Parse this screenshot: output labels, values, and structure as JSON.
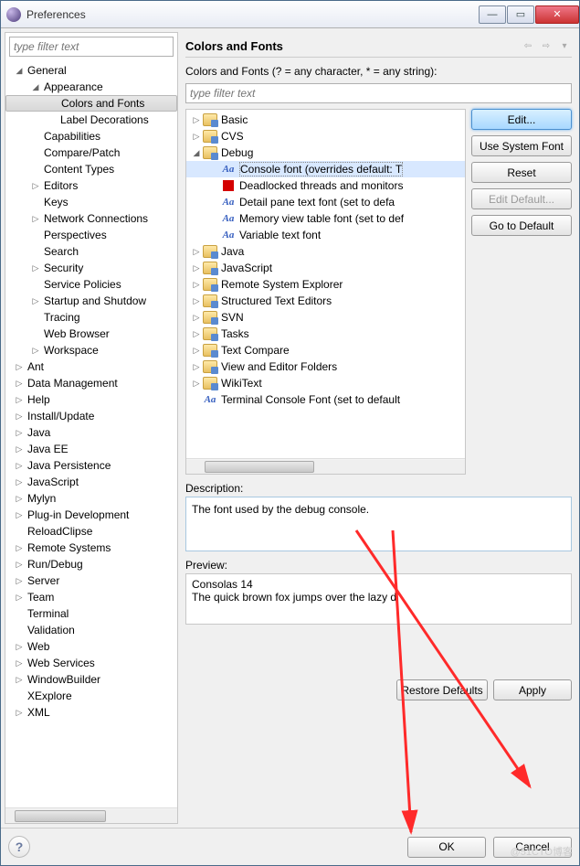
{
  "window": {
    "title": "Preferences"
  },
  "left_filter": {
    "placeholder": "type filter text"
  },
  "left_tree": [
    {
      "label": "General",
      "depth": 0,
      "exp": "open",
      "children": [
        {
          "label": "Appearance",
          "depth": 1,
          "exp": "open",
          "children": [
            {
              "label": "Colors and Fonts",
              "depth": 2,
              "selected": true
            },
            {
              "label": "Label Decorations",
              "depth": 2
            }
          ]
        },
        {
          "label": "Capabilities",
          "depth": 1
        },
        {
          "label": "Compare/Patch",
          "depth": 1
        },
        {
          "label": "Content Types",
          "depth": 1
        },
        {
          "label": "Editors",
          "depth": 1,
          "exp": "closed"
        },
        {
          "label": "Keys",
          "depth": 1
        },
        {
          "label": "Network Connections",
          "depth": 1,
          "exp": "closed"
        },
        {
          "label": "Perspectives",
          "depth": 1
        },
        {
          "label": "Search",
          "depth": 1
        },
        {
          "label": "Security",
          "depth": 1,
          "exp": "closed"
        },
        {
          "label": "Service Policies",
          "depth": 1
        },
        {
          "label": "Startup and Shutdow",
          "depth": 1,
          "exp": "closed"
        },
        {
          "label": "Tracing",
          "depth": 1
        },
        {
          "label": "Web Browser",
          "depth": 1
        },
        {
          "label": "Workspace",
          "depth": 1,
          "exp": "closed"
        }
      ]
    },
    {
      "label": "Ant",
      "depth": 0,
      "exp": "closed"
    },
    {
      "label": "Data Management",
      "depth": 0,
      "exp": "closed"
    },
    {
      "label": "Help",
      "depth": 0,
      "exp": "closed"
    },
    {
      "label": "Install/Update",
      "depth": 0,
      "exp": "closed"
    },
    {
      "label": "Java",
      "depth": 0,
      "exp": "closed"
    },
    {
      "label": "Java EE",
      "depth": 0,
      "exp": "closed"
    },
    {
      "label": "Java Persistence",
      "depth": 0,
      "exp": "closed"
    },
    {
      "label": "JavaScript",
      "depth": 0,
      "exp": "closed"
    },
    {
      "label": "Mylyn",
      "depth": 0,
      "exp": "closed"
    },
    {
      "label": "Plug-in Development",
      "depth": 0,
      "exp": "closed"
    },
    {
      "label": "ReloadClipse",
      "depth": 0
    },
    {
      "label": "Remote Systems",
      "depth": 0,
      "exp": "closed"
    },
    {
      "label": "Run/Debug",
      "depth": 0,
      "exp": "closed"
    },
    {
      "label": "Server",
      "depth": 0,
      "exp": "closed"
    },
    {
      "label": "Team",
      "depth": 0,
      "exp": "closed"
    },
    {
      "label": "Terminal",
      "depth": 0
    },
    {
      "label": "Validation",
      "depth": 0
    },
    {
      "label": "Web",
      "depth": 0,
      "exp": "closed"
    },
    {
      "label": "Web Services",
      "depth": 0,
      "exp": "closed"
    },
    {
      "label": "WindowBuilder",
      "depth": 0,
      "exp": "closed"
    },
    {
      "label": "XExplore",
      "depth": 0
    },
    {
      "label": "XML",
      "depth": 0,
      "exp": "closed"
    }
  ],
  "page": {
    "heading": "Colors and Fonts",
    "instruction": "Colors and Fonts (? = any character, * = any string):"
  },
  "right_filter": {
    "placeholder": "type filter text"
  },
  "font_tree": [
    {
      "label": "Basic",
      "depth": 0,
      "icon": "folder",
      "exp": "closed"
    },
    {
      "label": "CVS",
      "depth": 0,
      "icon": "folder",
      "exp": "closed"
    },
    {
      "label": "Debug",
      "depth": 0,
      "icon": "folder",
      "exp": "open",
      "children": [
        {
          "label": "Console font (overrides default: T",
          "depth": 1,
          "icon": "aa",
          "selected": true
        },
        {
          "label": "Deadlocked threads and monitors",
          "depth": 1,
          "icon": "red"
        },
        {
          "label": "Detail pane text font (set to defa",
          "depth": 1,
          "icon": "aa"
        },
        {
          "label": "Memory view table font (set to def",
          "depth": 1,
          "icon": "aa"
        },
        {
          "label": "Variable text font",
          "depth": 1,
          "icon": "aa"
        }
      ]
    },
    {
      "label": "Java",
      "depth": 0,
      "icon": "folder",
      "exp": "closed"
    },
    {
      "label": "JavaScript",
      "depth": 0,
      "icon": "folder",
      "exp": "closed"
    },
    {
      "label": "Remote System Explorer",
      "depth": 0,
      "icon": "folder",
      "exp": "closed"
    },
    {
      "label": "Structured Text Editors",
      "depth": 0,
      "icon": "folder",
      "exp": "closed"
    },
    {
      "label": "SVN",
      "depth": 0,
      "icon": "folder",
      "exp": "closed"
    },
    {
      "label": "Tasks",
      "depth": 0,
      "icon": "folder",
      "exp": "closed"
    },
    {
      "label": "Text Compare",
      "depth": 0,
      "icon": "folder",
      "exp": "closed"
    },
    {
      "label": "View and Editor Folders",
      "depth": 0,
      "icon": "folder",
      "exp": "closed"
    },
    {
      "label": "WikiText",
      "depth": 0,
      "icon": "folder",
      "exp": "closed"
    },
    {
      "label": "Terminal Console Font (set to default",
      "depth": 0,
      "icon": "aa"
    }
  ],
  "buttons": {
    "edit": "Edit...",
    "use_system": "Use System Font",
    "reset": "Reset",
    "edit_default": "Edit Default...",
    "go_to_default": "Go to Default",
    "restore_defaults": "Restore Defaults",
    "apply": "Apply",
    "ok": "OK",
    "cancel": "Cancel"
  },
  "description": {
    "label": "Description:",
    "text": "The font used by the debug console."
  },
  "preview": {
    "label": "Preview:",
    "line1": "Consolas 14",
    "line2": "The quick brown fox jumps over the lazy d"
  },
  "aa_glyph": "Aa",
  "watermark": "@51CTO博客"
}
